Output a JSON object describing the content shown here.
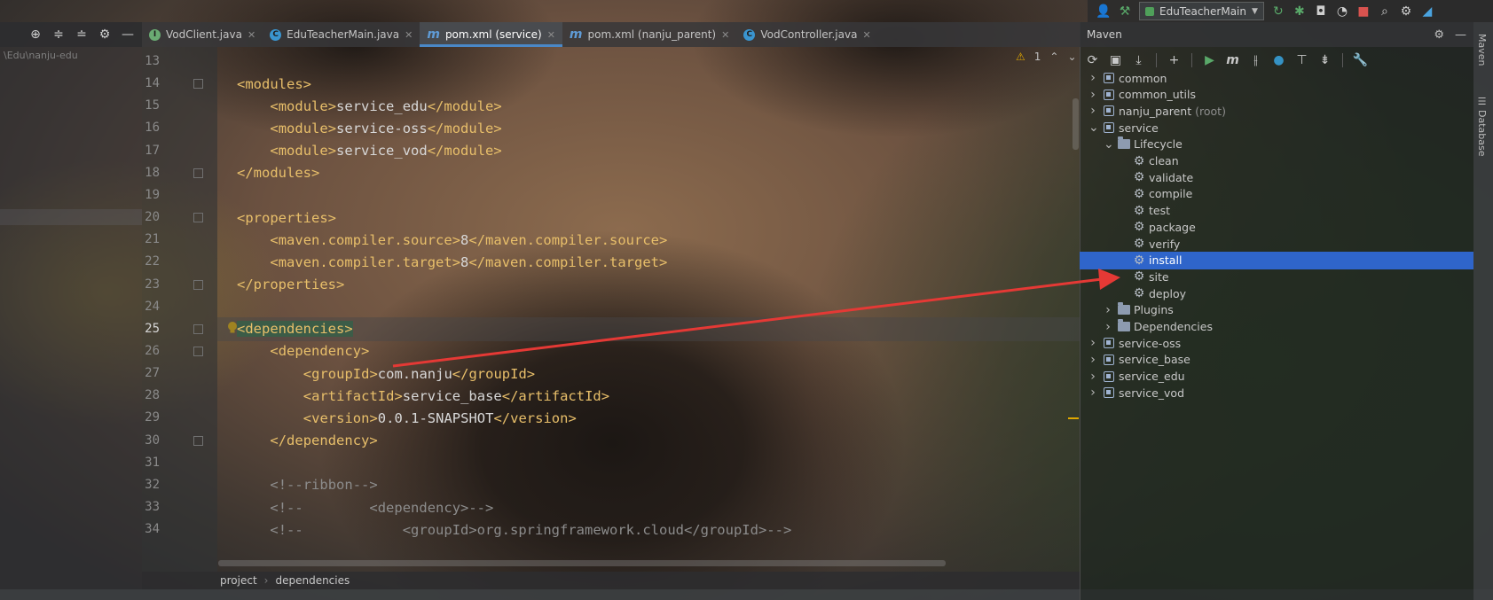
{
  "run_toolbar": {
    "config_label": "EduTeacherMain",
    "icons": [
      "user-icon",
      "hammer-icon",
      "rerun-icon",
      "debug-icon",
      "coverage-icon",
      "profile-icon",
      "stop-icon",
      "search-icon",
      "settings-icon",
      "plugin-icon"
    ]
  },
  "project": {
    "path_fragment": "\\Edu\\nanju-edu"
  },
  "tabs": [
    {
      "label": "VodClient.java",
      "icon": "interface-icon",
      "active": false
    },
    {
      "label": "EduTeacherMain.java",
      "icon": "class-run-icon",
      "active": false
    },
    {
      "label": "pom.xml (service)",
      "icon": "maven-icon",
      "active": true
    },
    {
      "label": "pom.xml (nanju_parent)",
      "icon": "maven-icon",
      "active": false
    },
    {
      "label": "VodController.java",
      "icon": "class-icon",
      "active": false
    }
  ],
  "editor": {
    "warning_count": "1",
    "current_line": "25",
    "lines": [
      {
        "n": "13",
        "indent": 0,
        "parts": []
      },
      {
        "n": "14",
        "indent": 0,
        "parts": [
          [
            "t",
            "<modules>"
          ]
        ]
      },
      {
        "n": "15",
        "indent": 1,
        "parts": [
          [
            "t",
            "<module>"
          ],
          [
            "x",
            "service_edu"
          ],
          [
            "t",
            "</module>"
          ]
        ]
      },
      {
        "n": "16",
        "indent": 1,
        "parts": [
          [
            "t",
            "<module>"
          ],
          [
            "x",
            "service-oss"
          ],
          [
            "t",
            "</module>"
          ]
        ]
      },
      {
        "n": "17",
        "indent": 1,
        "parts": [
          [
            "t",
            "<module>"
          ],
          [
            "x",
            "service_vod"
          ],
          [
            "t",
            "</module>"
          ]
        ]
      },
      {
        "n": "18",
        "indent": 0,
        "parts": [
          [
            "t",
            "</modules>"
          ]
        ]
      },
      {
        "n": "19",
        "indent": 0,
        "parts": []
      },
      {
        "n": "20",
        "indent": 0,
        "parts": [
          [
            "t",
            "<properties>"
          ]
        ]
      },
      {
        "n": "21",
        "indent": 1,
        "parts": [
          [
            "t",
            "<maven.compiler.source>"
          ],
          [
            "x",
            "8"
          ],
          [
            "t",
            "</maven.compiler.source>"
          ]
        ]
      },
      {
        "n": "22",
        "indent": 1,
        "parts": [
          [
            "t",
            "<maven.compiler.target>"
          ],
          [
            "x",
            "8"
          ],
          [
            "t",
            "</maven.compiler.target>"
          ]
        ]
      },
      {
        "n": "23",
        "indent": 0,
        "parts": [
          [
            "t",
            "</properties>"
          ]
        ]
      },
      {
        "n": "24",
        "indent": 0,
        "parts": []
      },
      {
        "n": "25",
        "indent": 0,
        "parts": [
          [
            "h",
            "<dependencies>"
          ]
        ]
      },
      {
        "n": "26",
        "indent": 1,
        "parts": [
          [
            "t",
            "<dependency>"
          ]
        ]
      },
      {
        "n": "27",
        "indent": 2,
        "parts": [
          [
            "t",
            "<groupId>"
          ],
          [
            "x",
            "com.nanju"
          ],
          [
            "t",
            "</groupId>"
          ]
        ]
      },
      {
        "n": "28",
        "indent": 2,
        "parts": [
          [
            "t",
            "<artifactId>"
          ],
          [
            "x",
            "service_base"
          ],
          [
            "t",
            "</artifactId>"
          ]
        ]
      },
      {
        "n": "29",
        "indent": 2,
        "parts": [
          [
            "t",
            "<version>"
          ],
          [
            "x",
            "0.0.1-SNAPSHOT"
          ],
          [
            "t",
            "</version>"
          ]
        ]
      },
      {
        "n": "30",
        "indent": 1,
        "parts": [
          [
            "t",
            "</dependency>"
          ]
        ]
      },
      {
        "n": "31",
        "indent": 0,
        "parts": []
      },
      {
        "n": "32",
        "indent": 1,
        "parts": [
          [
            "c",
            "<!--ribbon-->"
          ]
        ]
      },
      {
        "n": "33",
        "indent": 1,
        "parts": [
          [
            "c",
            "<!--        <dependency>-->"
          ]
        ]
      },
      {
        "n": "34",
        "indent": 1,
        "parts": [
          [
            "c",
            "<!--            <groupId>org.springframework.cloud</groupId>-->"
          ]
        ]
      }
    ]
  },
  "breadcrumb": [
    "project",
    "dependencies"
  ],
  "maven": {
    "title": "Maven",
    "toolbar_icons": [
      "reload-icon",
      "add-project-icon",
      "download-icon",
      "plus-icon",
      "run-icon",
      "execute-goal-icon",
      "skip-tests-icon",
      "offline-icon",
      "show-dependencies-icon",
      "collapse-icon",
      "settings-wrench-icon"
    ],
    "tree": [
      {
        "label": "common",
        "depth": 0,
        "expand": "collapsed",
        "icon": "module"
      },
      {
        "label": "common_utils",
        "depth": 0,
        "expand": "collapsed",
        "icon": "module"
      },
      {
        "label": "nanju_parent",
        "suffix": "(root)",
        "depth": 0,
        "expand": "collapsed",
        "icon": "module"
      },
      {
        "label": "service",
        "depth": 0,
        "expand": "expanded",
        "icon": "module"
      },
      {
        "label": "Lifecycle",
        "depth": 1,
        "expand": "expanded",
        "icon": "folder"
      },
      {
        "label": "clean",
        "depth": 2,
        "expand": "none",
        "icon": "gear"
      },
      {
        "label": "validate",
        "depth": 2,
        "expand": "none",
        "icon": "gear"
      },
      {
        "label": "compile",
        "depth": 2,
        "expand": "none",
        "icon": "gear"
      },
      {
        "label": "test",
        "depth": 2,
        "expand": "none",
        "icon": "gear"
      },
      {
        "label": "package",
        "depth": 2,
        "expand": "none",
        "icon": "gear"
      },
      {
        "label": "verify",
        "depth": 2,
        "expand": "none",
        "icon": "gear"
      },
      {
        "label": "install",
        "depth": 2,
        "expand": "none",
        "icon": "gear",
        "selected": true
      },
      {
        "label": "site",
        "depth": 2,
        "expand": "none",
        "icon": "gear"
      },
      {
        "label": "deploy",
        "depth": 2,
        "expand": "none",
        "icon": "gear"
      },
      {
        "label": "Plugins",
        "depth": 1,
        "expand": "collapsed",
        "icon": "folder"
      },
      {
        "label": "Dependencies",
        "depth": 1,
        "expand": "collapsed",
        "icon": "folder"
      },
      {
        "label": "service-oss",
        "depth": 0,
        "expand": "collapsed",
        "icon": "module"
      },
      {
        "label": "service_base",
        "depth": 0,
        "expand": "collapsed",
        "icon": "module"
      },
      {
        "label": "service_edu",
        "depth": 0,
        "expand": "collapsed",
        "icon": "module"
      },
      {
        "label": "service_vod",
        "depth": 0,
        "expand": "collapsed",
        "icon": "module"
      }
    ]
  },
  "side_tabs": [
    "Maven",
    "Database"
  ],
  "colors": {
    "selection": "#2f65ca",
    "tag": "#e8bf6a",
    "annotation_arrow": "#e53935",
    "active_tab_underline": "#4a88c7"
  }
}
